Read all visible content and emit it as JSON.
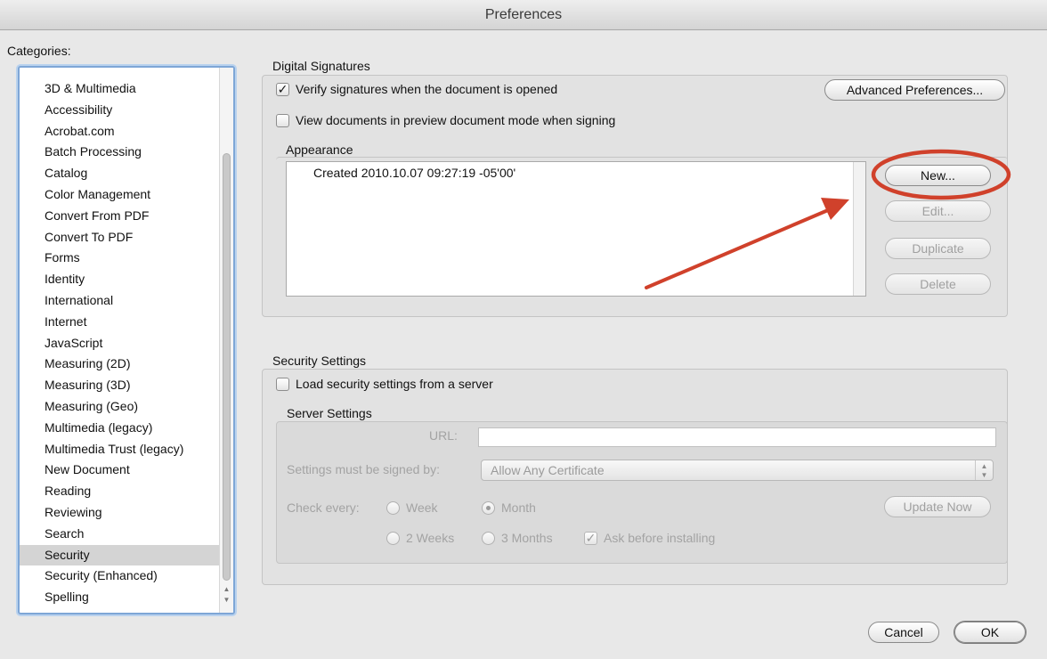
{
  "window": {
    "title": "Preferences"
  },
  "categories": {
    "label": "Categories:",
    "items": [
      "3D & Multimedia",
      "Accessibility",
      "Acrobat.com",
      "Batch Processing",
      "Catalog",
      "Color Management",
      "Convert From PDF",
      "Convert To PDF",
      "Forms",
      "Identity",
      "International",
      "Internet",
      "JavaScript",
      "Measuring (2D)",
      "Measuring (3D)",
      "Measuring (Geo)",
      "Multimedia (legacy)",
      "Multimedia Trust (legacy)",
      "New Document",
      "Reading",
      "Reviewing",
      "Search",
      "Security",
      "Security (Enhanced)",
      "Spelling"
    ],
    "selected": "Security"
  },
  "digital_signatures": {
    "title": "Digital Signatures",
    "verify_label": "Verify signatures when the document is opened",
    "verify_checked": true,
    "preview_label": "View documents in preview document mode when signing",
    "preview_checked": false,
    "advanced_button": "Advanced Preferences...",
    "appearance": {
      "title": "Appearance",
      "items": [
        "Created 2010.10.07 09:27:19 -05'00'"
      ],
      "buttons": {
        "new": "New...",
        "edit": "Edit...",
        "duplicate": "Duplicate",
        "delete": "Delete"
      }
    }
  },
  "security_settings": {
    "title": "Security Settings",
    "load_label": "Load security settings from a server",
    "load_checked": false,
    "server": {
      "title": "Server Settings",
      "url_label": "URL:",
      "url_value": "",
      "signed_by_label": "Settings must be signed by:",
      "signed_by_value": "Allow Any Certificate",
      "check_every_label": "Check every:",
      "options": {
        "week": "Week",
        "month": "Month",
        "two_weeks": "2 Weeks",
        "three_months": "3 Months"
      },
      "selected_interval": "Month",
      "ask_label": "Ask before installing",
      "ask_checked": true,
      "update_button": "Update Now"
    }
  },
  "footer": {
    "cancel": "Cancel",
    "ok": "OK"
  },
  "colors": {
    "annotation": "#d0412b",
    "selection": "#d4d4d4",
    "focus": "#7ea6d6"
  },
  "icons": {
    "check": "checkmark-icon",
    "annotation": "red-arrow-and-circle"
  }
}
